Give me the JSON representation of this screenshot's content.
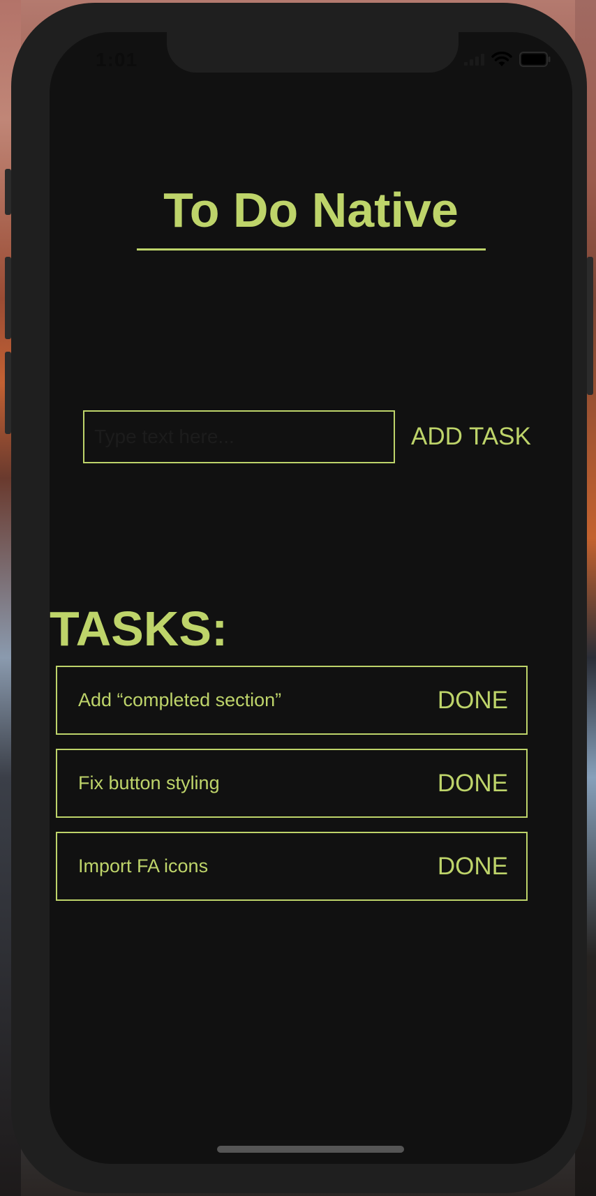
{
  "status_bar": {
    "time": "1:01",
    "icons": [
      "signal-icon",
      "wifi-icon",
      "battery-icon"
    ]
  },
  "app": {
    "title": "To Do Native",
    "input_placeholder": "Type text here...",
    "input_value": "",
    "add_button_label": "ADD TASK",
    "tasks_heading": "TASKS:",
    "tasks": [
      {
        "text": "Add “completed section”",
        "action_label": "DONE"
      },
      {
        "text": "Fix button styling",
        "action_label": "DONE"
      },
      {
        "text": "Import FA icons",
        "action_label": "DONE"
      }
    ]
  },
  "colors": {
    "accent": "#bed46a",
    "screen_background": "#111111",
    "bezel": "#1f1f1f"
  }
}
